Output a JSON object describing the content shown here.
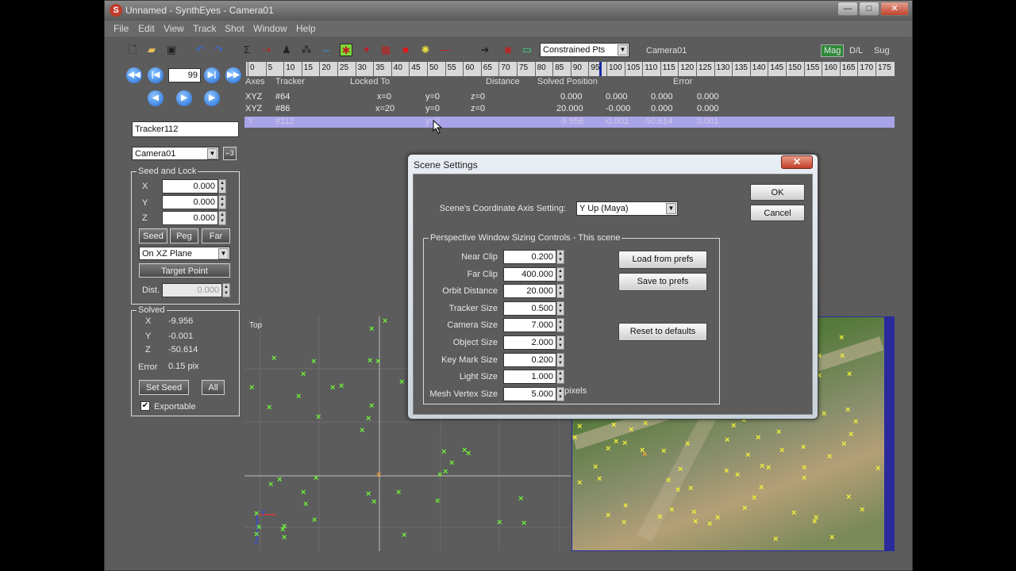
{
  "window": {
    "title": "Unnamed - SynthEyes - Camera01",
    "controls": [
      "—",
      "□",
      "✕"
    ]
  },
  "menu": [
    "File",
    "Edit",
    "View",
    "Track",
    "Shot",
    "Window",
    "Help"
  ],
  "toolbar": {
    "mode_select": "Constrained Pts",
    "camera_label": "Camera01",
    "view_buttons": [
      "Mag",
      "D/L",
      "Sug"
    ]
  },
  "timeline": {
    "frame_value": "99",
    "ticks": [
      "0",
      "5",
      "10",
      "15",
      "20",
      "25",
      "30",
      "35",
      "40",
      "45",
      "50",
      "55",
      "60",
      "65",
      "70",
      "75",
      "80",
      "85",
      "90",
      "95",
      "100",
      "105",
      "110",
      "115",
      "120",
      "125",
      "130",
      "135",
      "140",
      "145",
      "150",
      "155",
      "160",
      "165",
      "170",
      "175"
    ]
  },
  "left_panel": {
    "tracker_name": "Tracker112",
    "camera_select": "Camera01",
    "seed_lock": {
      "title": "Seed and Lock",
      "x_label": "X",
      "x_value": "0.000",
      "y_label": "Y",
      "y_value": "0.000",
      "z_label": "Z",
      "z_value": "0.000",
      "buttons": [
        "Seed",
        "Peg",
        "Far"
      ],
      "plane_select": "On XZ Plane",
      "target_point": "Target Point",
      "dist_label": "Dist.",
      "dist_value": "0.000"
    },
    "solved": {
      "title": "Solved",
      "x_label": "X",
      "x_value": "-9.956",
      "y_label": "Y",
      "y_value": "-0.001",
      "z_label": "Z",
      "z_value": "-50.614",
      "error_label": "Error",
      "error_value": "0.15 pix",
      "set_seed": "Set Seed",
      "all": "All",
      "exportable": "Exportable"
    }
  },
  "table": {
    "headers": [
      "Axes",
      "Tracker",
      "Locked To",
      "Distance",
      "Solved Position",
      "Error"
    ],
    "rows": [
      {
        "axes": "XYZ",
        "tracker": "#64",
        "lx": "x=0",
        "ly": "y=0",
        "lz": "z=0",
        "sx": "0.000",
        "sy": "0.000",
        "sz": "0.000",
        "err": "0.000"
      },
      {
        "axes": "XYZ",
        "tracker": "#86",
        "lx": "x=20",
        "ly": "y=0",
        "lz": "z=0",
        "sx": "20.000",
        "sy": "-0.000",
        "sz": "0.000",
        "err": "0.000"
      },
      {
        "axes": "Y",
        "tracker": "#112",
        "lx": "",
        "ly": "y=0",
        "lz": "",
        "sx": "-9.956",
        "sy": "-0.001",
        "sz": "-50.614",
        "err": "0.001"
      }
    ]
  },
  "viewport": {
    "label": "Top",
    "axis_y": "Y",
    "axis_z": "Z"
  },
  "dialog": {
    "title": "Scene Settings",
    "ok": "OK",
    "cancel": "Cancel",
    "coord_label": "Scene's Coordinate  Axis Setting:",
    "coord_value": "Y Up (Maya)",
    "group_title": "Perspective Window Sizing Controls - This scene",
    "fields": [
      {
        "label": "Near Clip",
        "value": "0.200"
      },
      {
        "label": "Far Clip",
        "value": "400.000"
      },
      {
        "label": "Orbit Distance",
        "value": "20.000"
      },
      {
        "label": "Tracker Size",
        "value": "0.500"
      },
      {
        "label": "Camera Size",
        "value": "7.000"
      },
      {
        "label": "Object Size",
        "value": "2.000"
      },
      {
        "label": "Key Mark Size",
        "value": "0.200"
      },
      {
        "label": "Light Size",
        "value": "1.000"
      },
      {
        "label": "Mesh Vertex Size",
        "value": "5.000"
      }
    ],
    "pixels_label": "pixels",
    "load_prefs": "Load from prefs",
    "save_prefs": "Save to prefs",
    "reset_defaults": "Reset to defaults"
  }
}
